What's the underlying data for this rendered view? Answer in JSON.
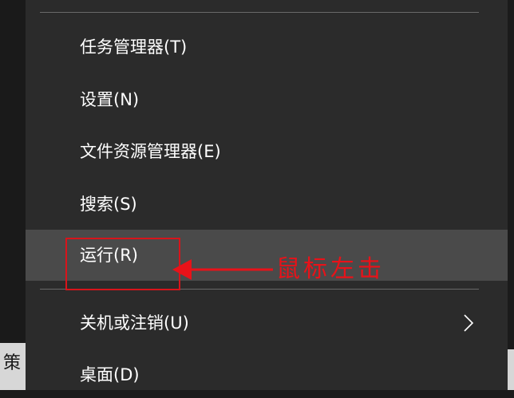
{
  "menu": {
    "items": [
      {
        "label": "任务管理器(T)"
      },
      {
        "label": "设置(N)"
      },
      {
        "label": "文件资源管理器(E)"
      },
      {
        "label": "搜索(S)"
      },
      {
        "label": "运行(R)",
        "highlighted": true
      },
      {
        "label": "关机或注销(U)",
        "has_submenu": true
      },
      {
        "label": "桌面(D)"
      }
    ]
  },
  "background": {
    "partial_text": "策"
  },
  "annotation": {
    "text": "鼠标左击",
    "color": "#e81219"
  },
  "colors": {
    "menu_bg": "#2b2b2b",
    "highlight_bg": "#4a4a4a",
    "separator": "#6a6a6a",
    "text": "#ffffff"
  },
  "icons": {
    "submenu": "chevron-right-icon",
    "pointer": "arrow-left-icon"
  }
}
